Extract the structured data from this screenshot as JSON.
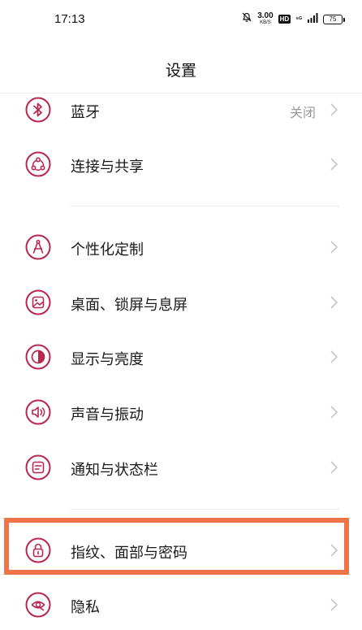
{
  "status_bar": {
    "time": "17:13",
    "speed_value": "3.00",
    "speed_unit": "KB/S",
    "hd_badge": "HD",
    "network": "⁵ᴳ",
    "battery": "75"
  },
  "title": "设置",
  "accent_color": "#b8274f",
  "highlight_color": "#f07448",
  "items": [
    {
      "label": "蓝牙",
      "value": "关闭",
      "icon": "bluetooth-icon"
    },
    {
      "label": "连接与共享",
      "value": "",
      "icon": "share-connect-icon"
    },
    {
      "label": "个性化定制",
      "value": "",
      "icon": "compass-icon"
    },
    {
      "label": "桌面、锁屏与息屏",
      "value": "",
      "icon": "wallpaper-icon"
    },
    {
      "label": "显示与亮度",
      "value": "",
      "icon": "brightness-icon"
    },
    {
      "label": "声音与振动",
      "value": "",
      "icon": "speaker-icon"
    },
    {
      "label": "通知与状态栏",
      "value": "",
      "icon": "notification-icon"
    },
    {
      "label": "指纹、面部与密码",
      "value": "",
      "icon": "lock-icon"
    },
    {
      "label": "隐私",
      "value": "",
      "icon": "eye-icon"
    }
  ]
}
